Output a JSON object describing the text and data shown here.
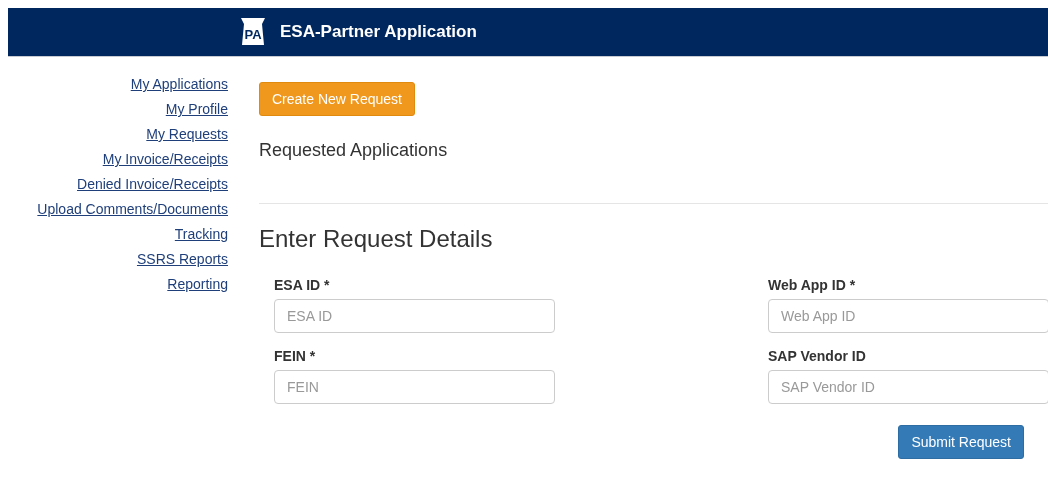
{
  "header": {
    "logo_text": "PA",
    "title": "ESA-Partner Application"
  },
  "sidebar": {
    "items": [
      {
        "label": "My Applications"
      },
      {
        "label": "My Profile"
      },
      {
        "label": "My Requests"
      },
      {
        "label": "My Invoice/Receipts"
      },
      {
        "label": "Denied Invoice/Receipts"
      },
      {
        "label": "Upload Comments/Documents"
      },
      {
        "label": "Tracking"
      },
      {
        "label": "SSRS Reports"
      },
      {
        "label": "Reporting"
      }
    ]
  },
  "create_button": "Create New Request",
  "requested_heading": "Requested Applications",
  "form": {
    "title": "Enter Request Details",
    "fields": [
      {
        "label": "ESA ID *",
        "placeholder": "ESA ID"
      },
      {
        "label": "Web App ID *",
        "placeholder": "Web App ID"
      },
      {
        "label": "FEIN *",
        "placeholder": "FEIN"
      },
      {
        "label": "SAP Vendor ID",
        "placeholder": "SAP Vendor ID"
      }
    ],
    "submit": "Submit Request"
  }
}
